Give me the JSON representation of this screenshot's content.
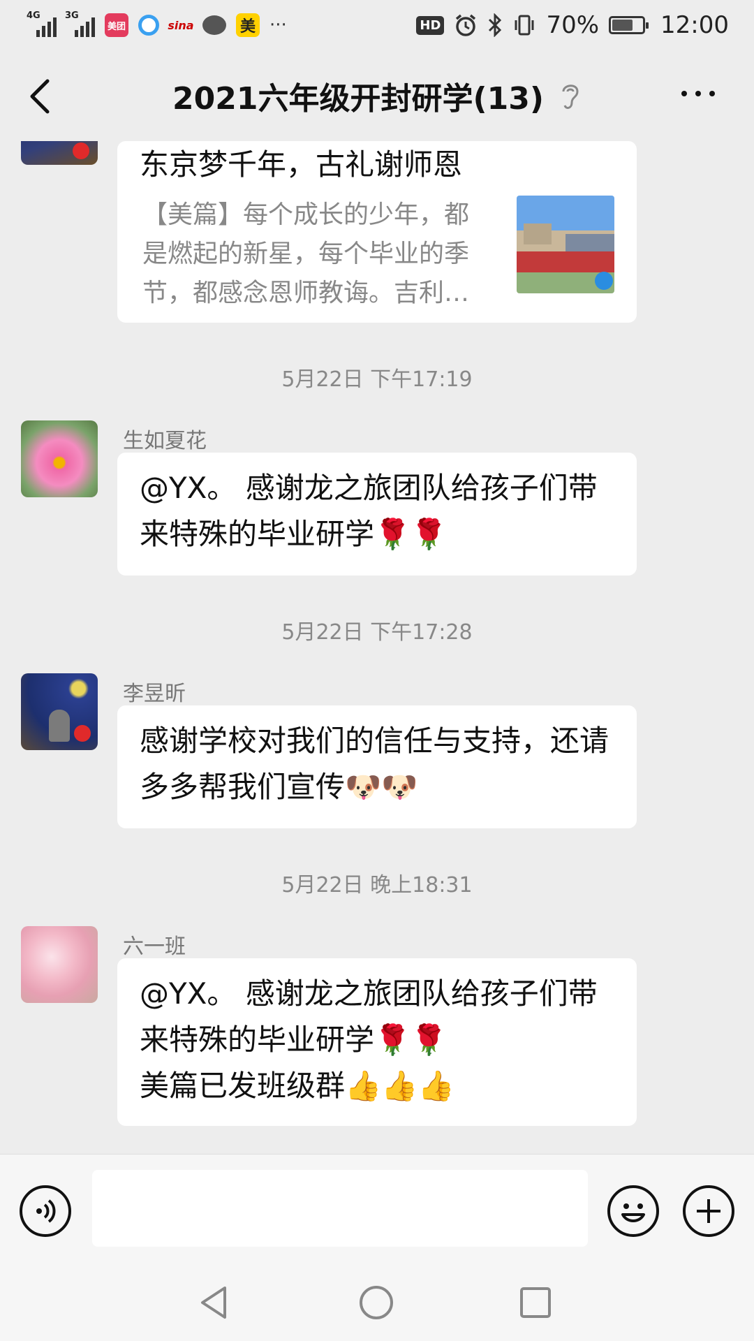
{
  "status_bar": {
    "net1": "4G",
    "net2": "3G",
    "meituan_label": "美团",
    "sina_label": "sina",
    "mei_label": "美",
    "more_dots": "···",
    "hd": "HD",
    "battery_percent": "70%",
    "battery_level": 0.7,
    "time": "12:00"
  },
  "header": {
    "title": "2021六年级开封研学(13)"
  },
  "messages": {
    "card": {
      "title": "东京梦千年，古礼谢师恩",
      "desc": "【美篇】每个成长的少年，都是燃起的新星，每个毕业的季节，都感念恩师教诲。吉利…"
    },
    "time1": "5月22日 下午17:19",
    "msg1": {
      "sender": "生如夏花",
      "text": "@YX。 感谢龙之旅团队给孩子们带来特殊的毕业研学🌹🌹"
    },
    "time2": "5月22日 下午17:28",
    "msg2": {
      "sender": "李昱昕",
      "text": "感谢学校对我们的信任与支持，还请多多帮我们宣传🐶🐶"
    },
    "time3": "5月22日 晚上18:31",
    "msg3": {
      "sender": "六一班",
      "line1": " @YX。 感谢龙之旅团队给孩子们带来特殊的毕业研学🌹🌹",
      "line2": "美篇已发班级群👍👍👍"
    }
  },
  "input": {
    "value": "",
    "placeholder": ""
  },
  "icons": [
    "back-icon",
    "ear-icon",
    "more-icon",
    "voice-icon",
    "emoji-icon",
    "plus-icon",
    "nav-back-icon",
    "nav-home-icon",
    "nav-recent-icon"
  ]
}
